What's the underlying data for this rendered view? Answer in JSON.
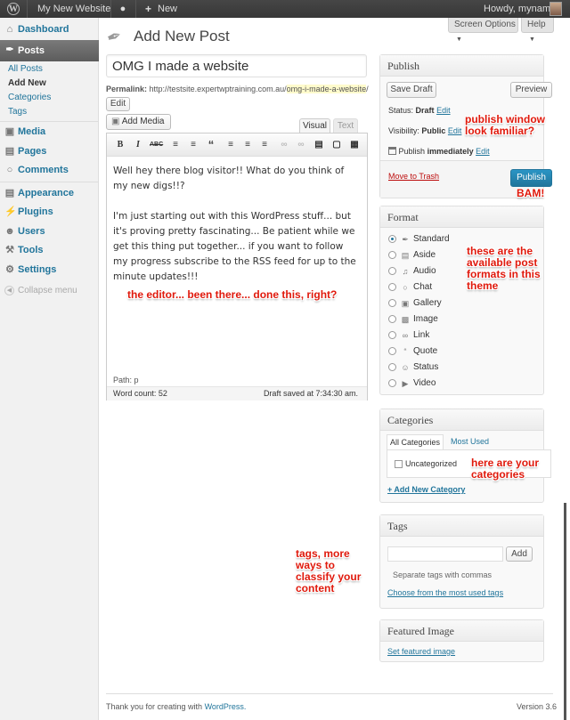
{
  "adminbar": {
    "site_name": "My New Website",
    "new_label": "New",
    "howdy": "Howdy, myname"
  },
  "menu": {
    "dashboard": "Dashboard",
    "posts": "Posts",
    "posts_sub": [
      "All Posts",
      "Add New",
      "Categories",
      "Tags"
    ],
    "media": "Media",
    "pages": "Pages",
    "comments": "Comments",
    "appearance": "Appearance",
    "plugins": "Plugins",
    "users": "Users",
    "tools": "Tools",
    "settings": "Settings",
    "collapse": "Collapse menu"
  },
  "header": {
    "title": "Add New Post",
    "screen_options": "Screen Options",
    "help": "Help"
  },
  "editor": {
    "post_title": "OMG I made a website",
    "permalink_label": "Permalink:",
    "permalink_base": "http://testsite.expertwptraining.com.au/",
    "permalink_slug": "omg-i-made-a-website",
    "permalink_end": "/",
    "edit_label": "Edit",
    "add_media": "Add Media",
    "tab_visual": "Visual",
    "tab_text": "Text",
    "content_p1": "Well hey there blog visitor!! What do you think of my new digs!!?",
    "content_p2": "I'm just starting out with this WordPress stuff... but it's proving pretty fascinating...  Be patient while we get this thing put together... if you want to follow my progress subscribe to the RSS feed for up to the minute updates!!!",
    "path": "Path: p",
    "word_count": "Word count: 52",
    "draft_saved": "Draft saved at 7:34:30 am."
  },
  "publish": {
    "title": "Publish",
    "save_draft": "Save Draft",
    "preview": "Preview",
    "status_label": "Status:",
    "status_value": "Draft",
    "status_edit": "Edit",
    "visibility_label": "Visibility:",
    "visibility_value": "Public",
    "visibility_edit": "Edit",
    "publish_label": "Publish",
    "publish_when": "immediately",
    "publish_edit": "Edit",
    "trash": "Move to Trash",
    "publish_button": "Publish"
  },
  "format": {
    "title": "Format",
    "options": [
      "Standard",
      "Aside",
      "Audio",
      "Chat",
      "Gallery",
      "Image",
      "Link",
      "Quote",
      "Status",
      "Video"
    ],
    "selected": "Standard"
  },
  "categories": {
    "title": "Categories",
    "tab_all": "All Categories",
    "tab_used": "Most Used",
    "items": [
      "Uncategorized"
    ],
    "add_new": "+ Add New Category"
  },
  "tags": {
    "title": "Tags",
    "input_value": "",
    "add_button": "Add",
    "hint": "Separate tags with commas",
    "choose": "Choose from the most used tags"
  },
  "featured": {
    "title": "Featured Image",
    "set": "Set featured image"
  },
  "footer": {
    "thanks": "Thank you for creating with",
    "wp_link": "WordPress.",
    "version": "Version 3.6"
  },
  "annotations": {
    "publish": "publish window look familiar?",
    "bam": "BAM!",
    "formats": "these are the available post formats in this theme",
    "editor": "the editor... been there... done this, right?",
    "categories": "here are your categories",
    "tags": "tags, more ways to classify your content"
  },
  "colors": {
    "link": "#21759b",
    "publish_button": "#2a95c5",
    "annotation": "#e0190c",
    "trash": "#bc0b0b",
    "adminbar": "#464646"
  }
}
